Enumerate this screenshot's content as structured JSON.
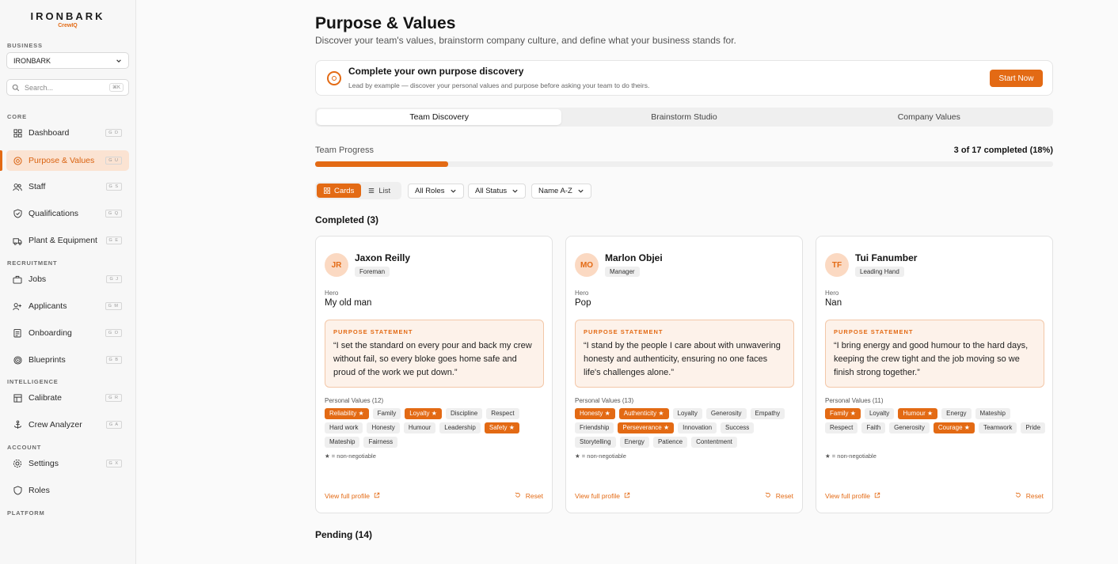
{
  "brand": {
    "name": "IRONBARK",
    "sub": "CrewIQ"
  },
  "sidebar": {
    "business_label": "BUSINESS",
    "business_value": "IRONBARK",
    "search_placeholder": "Search...",
    "search_kbd": "⌘K",
    "sections": {
      "core": "CORE",
      "recruitment": "RECRUITMENT",
      "intelligence": "INTELLIGENCE",
      "account": "ACCOUNT",
      "platform": "PLATFORM"
    },
    "items": [
      {
        "label": "Dashboard",
        "kbd": "G D"
      },
      {
        "label": "Purpose & Values",
        "kbd": "G U"
      },
      {
        "label": "Staff",
        "kbd": "G S"
      },
      {
        "label": "Qualifications",
        "kbd": "G Q"
      },
      {
        "label": "Plant & Equipment",
        "kbd": "G E"
      },
      {
        "label": "Jobs",
        "kbd": "G J"
      },
      {
        "label": "Applicants",
        "kbd": "G M"
      },
      {
        "label": "Onboarding",
        "kbd": "G O"
      },
      {
        "label": "Blueprints",
        "kbd": "G B"
      },
      {
        "label": "Calibrate",
        "kbd": "G R"
      },
      {
        "label": "Crew Analyzer",
        "kbd": "G A"
      },
      {
        "label": "Settings",
        "kbd": "G X"
      },
      {
        "label": "Roles",
        "kbd": ""
      }
    ]
  },
  "header": {
    "title": "Purpose & Values",
    "subtitle": "Discover your team's values, brainstorm company culture, and define what your business stands for."
  },
  "banner": {
    "title": "Complete your own purpose discovery",
    "desc": "Lead by example — discover your personal values and purpose before asking your team to do theirs.",
    "button": "Start Now"
  },
  "tabs": [
    "Team Discovery",
    "Brainstorm Studio",
    "Company Values"
  ],
  "progress": {
    "label": "Team Progress",
    "count": "3 of 17 completed (18%)",
    "fraction": 0.18
  },
  "view": {
    "cards": "Cards",
    "list": "List"
  },
  "filters": {
    "roles": "All Roles",
    "status": "All Status",
    "sort": "Name A-Z"
  },
  "completed_title": "Completed (3)",
  "pending_title": "Pending (14)",
  "accent": "#e36a14",
  "cards": [
    {
      "initials": "JR",
      "name": "Jaxon Reilly",
      "role": "Foreman",
      "hero_label": "Hero",
      "hero": "My old man",
      "purpose_label": "PURPOSE STATEMENT",
      "purpose": "“I set the standard on every pour and back my crew without fail, so every bloke goes home safe and proud of the work we put down.”",
      "values_label": "Personal Values (12)",
      "values": [
        {
          "t": "Reliability ★",
          "k": true
        },
        {
          "t": "Family",
          "k": false
        },
        {
          "t": "Loyalty ★",
          "k": true
        },
        {
          "t": "Discipline",
          "k": false
        },
        {
          "t": "Respect",
          "k": false
        },
        {
          "t": "Hard work",
          "k": false
        },
        {
          "t": "Honesty",
          "k": false
        },
        {
          "t": "Humour",
          "k": false
        },
        {
          "t": "Leadership",
          "k": false
        },
        {
          "t": "Safety ★",
          "k": true
        },
        {
          "t": "Mateship",
          "k": false
        },
        {
          "t": "Fairness",
          "k": false
        }
      ],
      "legend": "★ = non-negotiable",
      "view": "View full profile",
      "reset": "Reset"
    },
    {
      "initials": "MO",
      "name": "Marlon Objei",
      "role": "Manager",
      "hero_label": "Hero",
      "hero": "Pop",
      "purpose_label": "PURPOSE STATEMENT",
      "purpose": "“I stand by the people I care about with unwavering honesty and authenticity, ensuring no one faces life's challenges alone.”",
      "values_label": "Personal Values (13)",
      "values": [
        {
          "t": "Honesty ★",
          "k": true
        },
        {
          "t": "Authenticity ★",
          "k": true
        },
        {
          "t": "Loyalty",
          "k": false
        },
        {
          "t": "Generosity",
          "k": false
        },
        {
          "t": "Empathy",
          "k": false
        },
        {
          "t": "Friendship",
          "k": false
        },
        {
          "t": "Perseverance ★",
          "k": true
        },
        {
          "t": "Innovation",
          "k": false
        },
        {
          "t": "Success",
          "k": false
        },
        {
          "t": "Storytelling",
          "k": false
        },
        {
          "t": "Energy",
          "k": false
        },
        {
          "t": "Patience",
          "k": false
        },
        {
          "t": "Contentment",
          "k": false
        }
      ],
      "legend": "★ = non-negotiable",
      "view": "View full profile",
      "reset": "Reset"
    },
    {
      "initials": "TF",
      "name": "Tui Fanumber",
      "role": "Leading Hand",
      "hero_label": "Hero",
      "hero": "Nan",
      "purpose_label": "PURPOSE STATEMENT",
      "purpose": "“I bring energy and good humour to the hard days, keeping the crew tight and the job moving so we finish strong together.”",
      "values_label": "Personal Values (11)",
      "values": [
        {
          "t": "Family ★",
          "k": true
        },
        {
          "t": "Loyalty",
          "k": false
        },
        {
          "t": "Humour ★",
          "k": true
        },
        {
          "t": "Energy",
          "k": false
        },
        {
          "t": "Mateship",
          "k": false
        },
        {
          "t": "Respect",
          "k": false
        },
        {
          "t": "Faith",
          "k": false
        },
        {
          "t": "Generosity",
          "k": false
        },
        {
          "t": "Courage ★",
          "k": true
        },
        {
          "t": "Teamwork",
          "k": false
        },
        {
          "t": "Pride",
          "k": false
        }
      ],
      "legend": "★ = non-negotiable",
      "view": "View full profile",
      "reset": "Reset"
    }
  ]
}
